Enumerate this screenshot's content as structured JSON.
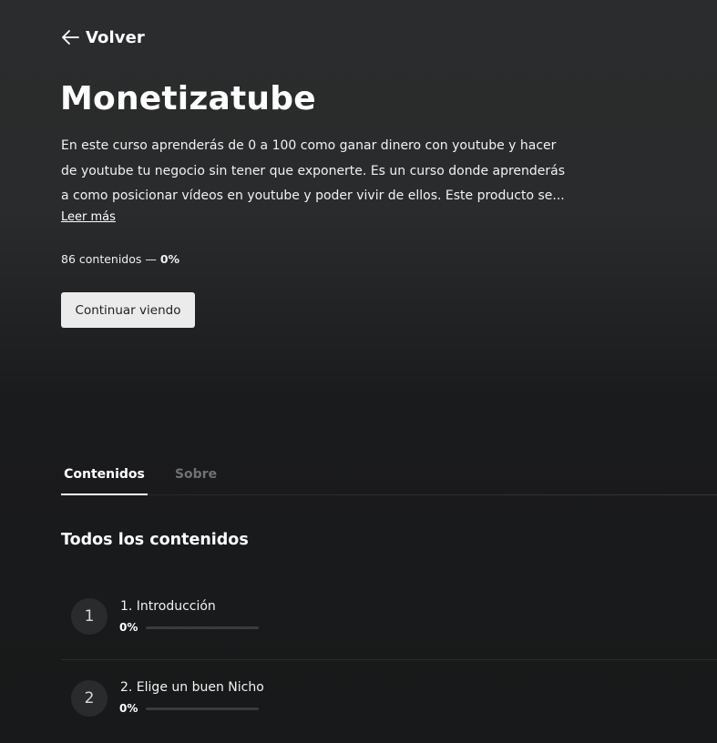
{
  "nav": {
    "back_label": "Volver",
    "back_icon": "arrow-left-icon"
  },
  "course": {
    "title": "Monetizatube",
    "description": "En este curso aprenderás de 0 a 100 como ganar dinero con youtube y hacer de youtube tu negocio sin tener que exponerte. Es un curso donde aprenderás a como posicionar vídeos en youtube y poder vivir de ellos. Este producto se...",
    "read_more": "Leer más",
    "content_count": "86 contenidos",
    "separator": " — ",
    "progress": "0%",
    "continue_button": "Continuar viendo"
  },
  "tabs": [
    {
      "label": "Contenidos",
      "active": true
    },
    {
      "label": "Sobre",
      "active": false
    }
  ],
  "section_title": "Todos los contenidos",
  "modules": [
    {
      "number": "1",
      "title": "1. Introducción",
      "progress": "0%",
      "progress_value": 0
    },
    {
      "number": "2",
      "title": "2. Elige un buen Nicho",
      "progress": "0%",
      "progress_value": 0
    }
  ],
  "colors": {
    "background": "#2b2c2d",
    "button_bg": "#ebebeb",
    "tab_inactive": "#6f7173"
  }
}
